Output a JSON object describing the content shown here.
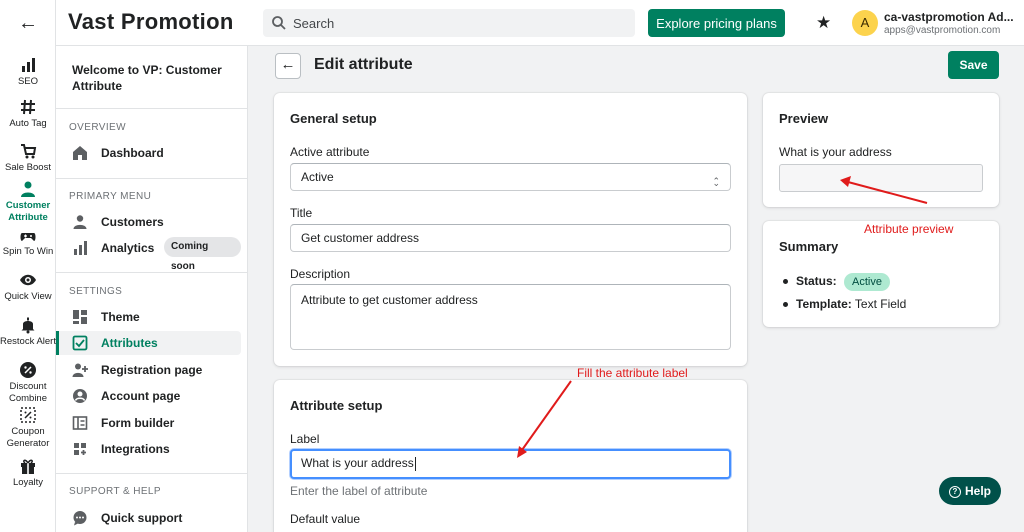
{
  "app": {
    "brand": "Vast Promotion",
    "search_placeholder": "Search",
    "explore_button": "Explore pricing plans",
    "user_initial": "A",
    "user_name": "ca-vastpromotion Ad...",
    "user_email": "apps@vastpromotion.com"
  },
  "rail": {
    "items": [
      {
        "label": "SEO",
        "icon": "bar-chart-icon"
      },
      {
        "label": "Auto Tag",
        "icon": "hash-icon"
      },
      {
        "label": "Sale Boost",
        "icon": "cart-icon"
      },
      {
        "label": "Customer Attribute",
        "icon": "person-icon"
      },
      {
        "label": "Spin To Win",
        "icon": "gamepad-icon"
      },
      {
        "label": "Quick View",
        "icon": "eye-icon"
      },
      {
        "label": "Restock Alert",
        "icon": "bell-icon"
      },
      {
        "label": "Discount Combine",
        "icon": "discount-icon"
      },
      {
        "label": "Coupon Generator",
        "icon": "coupon-icon"
      },
      {
        "label": "Loyalty",
        "icon": "gift-icon"
      }
    ]
  },
  "sidebar": {
    "welcome": "Welcome to VP: Customer Attribute",
    "overview_title": "OVERVIEW",
    "dashboard": "Dashboard",
    "primary_title": "PRIMARY MENU",
    "customers": "Customers",
    "analytics": "Analytics",
    "coming_soon": "Coming soon",
    "settings_title": "SETTINGS",
    "theme": "Theme",
    "attributes": "Attributes",
    "registration": "Registration page",
    "account": "Account page",
    "form_builder": "Form builder",
    "integrations": "Integrations",
    "support_title": "SUPPORT & HELP",
    "quick_support": "Quick support"
  },
  "page": {
    "title": "Edit attribute",
    "save": "Save"
  },
  "general": {
    "title": "General setup",
    "active_label": "Active attribute",
    "active_value": "Active",
    "title_label": "Title",
    "title_value": "Get customer address",
    "description_label": "Description",
    "description_value": "Attribute to get customer address"
  },
  "attribute_setup": {
    "title": "Attribute setup",
    "label_label": "Label",
    "label_value": "What is your address",
    "label_help": "Enter the label of attribute",
    "default_label": "Default value"
  },
  "preview": {
    "title": "Preview",
    "field_label": "What is your address"
  },
  "summary": {
    "title": "Summary",
    "status_key": "Status:",
    "status_value": "Active",
    "template_key": "Template:",
    "template_value": "Text Field"
  },
  "annotations": {
    "preview_note": "Attribute preview",
    "label_note": "Fill the attribute label"
  },
  "help_button": "Help",
  "colors": {
    "primary": "#008060",
    "annotation": "#e01b1b",
    "focus": "#458fff"
  }
}
